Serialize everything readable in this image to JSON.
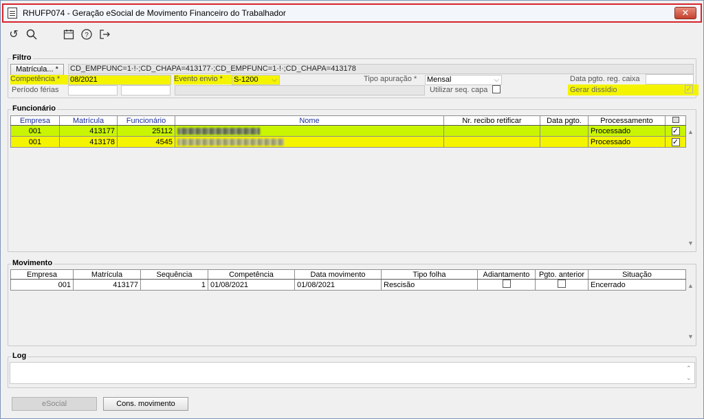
{
  "window": {
    "title": "RHUFP074 - Geração eSocial de Movimento Financeiro do Trabalhador",
    "close": "✕"
  },
  "toolbar": {
    "icons": [
      "refresh-icon",
      "search-icon",
      "calendar-icon",
      "help-icon",
      "exit-icon"
    ],
    "glyphs": {
      "refresh": "↺",
      "search": "⚲",
      "calendar": "▦",
      "help": "?",
      "exit": "↦"
    }
  },
  "filtro": {
    "label": "Filtro",
    "matricula_button": "Matrícula... *",
    "matricula_value": "CD_EMPFUNC=1·!·;CD_CHAPA=413177·;CD_EMPFUNC=1·!·;CD_CHAPA=413178",
    "competencia_label": "Competência *",
    "competencia_value": "08/2021",
    "evento_label": "Evento envio *",
    "evento_value": "S-1200",
    "tipo_apuracao_label": "Tipo apuração *",
    "tipo_apuracao_value": "Mensal",
    "data_pgto_label": "Data pgto. reg. caixa",
    "data_pgto_value": "",
    "periodo_ferias_label": "Período férias",
    "utilizar_seq_label": "Utilizar seq. capa",
    "gerar_dissidio_label": "Gerar dissídio"
  },
  "funcionario": {
    "label": "Funcionário",
    "columns": [
      "Empresa",
      "Matrícula",
      "Funcionário",
      "Nome",
      "Nr. recibo retificar",
      "Data pgto.",
      "Processamento"
    ],
    "rows": [
      {
        "empresa": "001",
        "matricula": "413177",
        "funcionario": "25112",
        "processamento": "Processado",
        "checked": "✓"
      },
      {
        "empresa": "001",
        "matricula": "413178",
        "funcionario": "4545",
        "processamento": "Processado",
        "checked": "✓"
      }
    ]
  },
  "movimento": {
    "label": "Movimento",
    "columns": [
      "Empresa",
      "Matrícula",
      "Sequência",
      "Competência",
      "Data movimento",
      "Tipo folha",
      "Adiantamento",
      "Pgto. anterior",
      "Situação"
    ],
    "rows": [
      {
        "empresa": "001",
        "matricula": "413177",
        "sequencia": "1",
        "competencia": "01/08/2021",
        "data_movimento": "01/08/2021",
        "tipo_folha": "Rescisão",
        "situacao": "Encerrado"
      }
    ]
  },
  "log": {
    "label": "Log"
  },
  "buttons": {
    "esocial": "eSocial",
    "cons_movimento": "Cons. movimento"
  },
  "colors": {
    "highlight_yellow": "#f4f400",
    "selection_green": "#c9f500",
    "title_border": "#d8232a"
  }
}
